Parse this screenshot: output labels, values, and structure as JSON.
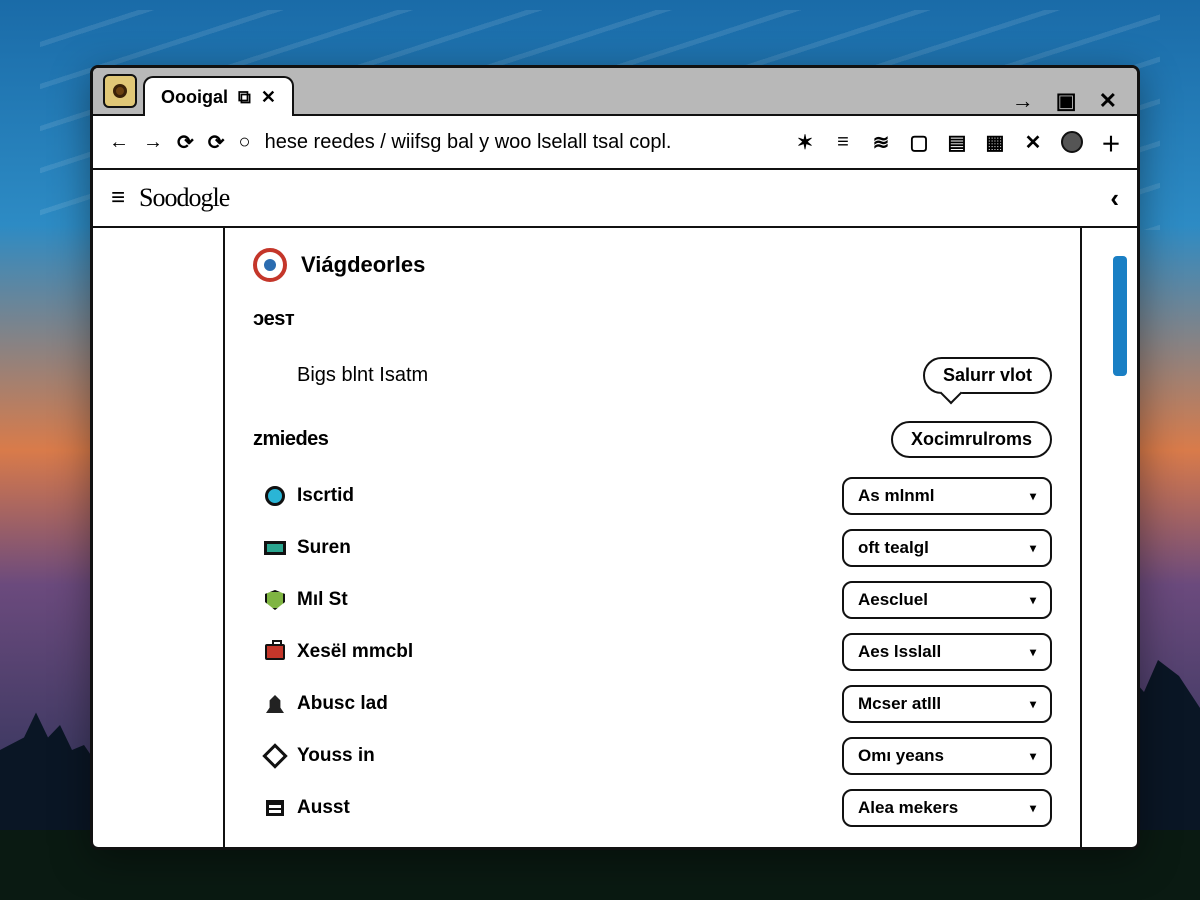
{
  "tab": {
    "title": "Oooigal",
    "restore_glyph": "⧉",
    "close_glyph": "✕"
  },
  "titlebar": {
    "forward": "→",
    "restore": "▣",
    "close": "✕"
  },
  "navbar": {
    "back": "←",
    "forward": "→",
    "reload1": "⟳",
    "reload2": "⟳",
    "url_prefix": "○",
    "url": "hese reedes / wiifsg bal y woo lselall tsal copl.",
    "icons": [
      "✶",
      "≡",
      "≋",
      "▢",
      "▤",
      "▦",
      "✕"
    ],
    "new_tab": "＋"
  },
  "appheader": {
    "menu": "≡",
    "brand": "Soodogle",
    "collapse": "‹"
  },
  "profile": {
    "name": "Viágdeorles"
  },
  "section1": {
    "title": "ɔesт",
    "row_label": "Bigs blnt Isatm",
    "button": "Salurr vlot"
  },
  "section2": {
    "title": "zmiedes",
    "header_button": "Xocimrulroms",
    "items": [
      {
        "icon": "circle-cyan",
        "label": "Iscrtid",
        "value": "As mlnml"
      },
      {
        "icon": "rect-teal",
        "label": "Suren",
        "value": "oft tealgl"
      },
      {
        "icon": "shield",
        "label": "Mıl St",
        "value": "Aescluel"
      },
      {
        "icon": "briefcase",
        "label": "Xesël mmcbl",
        "value": "Aes lsslall"
      },
      {
        "icon": "bell",
        "label": "Abusc lad",
        "value": "Mcser atlll"
      },
      {
        "icon": "diamond",
        "label": "Youss in",
        "value": "Omı yeans"
      },
      {
        "icon": "square",
        "label": "Ausst",
        "value": "Alea mekers"
      }
    ]
  }
}
